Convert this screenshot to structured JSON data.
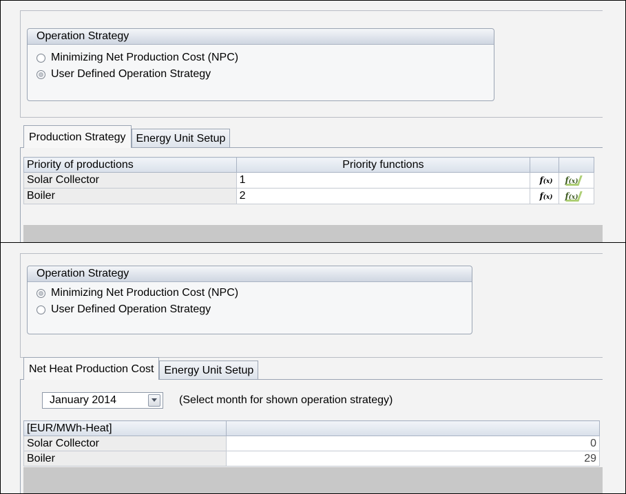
{
  "panel_top": {
    "group_title": "Operation Strategy",
    "options": [
      {
        "label": "Minimizing Net Production Cost (NPC)",
        "checked": false
      },
      {
        "label": "User Defined Operation Strategy",
        "checked": true
      }
    ],
    "tabs": [
      {
        "label": "Production Strategy",
        "active": true
      },
      {
        "label": "Energy Unit Setup",
        "active": false
      }
    ],
    "table": {
      "headers": [
        "Priority of productions",
        "Priority functions"
      ],
      "rows": [
        {
          "name": "Solar Collector",
          "value": "1"
        },
        {
          "name": "Boiler",
          "value": "2"
        }
      ],
      "fx_button_label": "f(x)",
      "fx_check_button_label": "f(x)"
    }
  },
  "panel_bottom": {
    "group_title": "Operation Strategy",
    "options": [
      {
        "label": "Minimizing Net Production Cost (NPC)",
        "checked": true
      },
      {
        "label": "User Defined Operation Strategy",
        "checked": false
      }
    ],
    "tabs": [
      {
        "label": "Net Heat Production Cost",
        "active": true
      },
      {
        "label": "Energy Unit Setup",
        "active": false
      }
    ],
    "month_select": {
      "value": "January 2014"
    },
    "month_hint": "(Select month for shown operation strategy)",
    "table": {
      "headers": [
        "[EUR/MWh-Heat]",
        ""
      ],
      "rows": [
        {
          "name": "Solar Collector",
          "value": "0"
        },
        {
          "name": "Boiler",
          "value": "29"
        }
      ]
    }
  }
}
